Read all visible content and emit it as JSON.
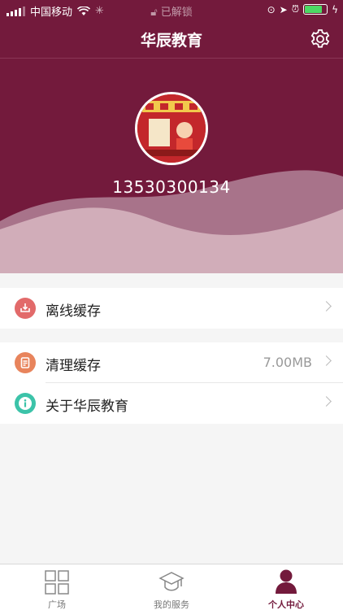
{
  "status_bar": {
    "carrier": "中国移动",
    "center": "已解锁"
  },
  "navbar": {
    "title": "华辰教育",
    "settings_icon": "gear-icon"
  },
  "profile": {
    "phone": "13530300134",
    "avatar_icon": "avatar"
  },
  "menu": {
    "offline_cache": {
      "label": "离线缓存",
      "icon": "download-icon",
      "color": "#e26a6a"
    },
    "clear_cache": {
      "label": "清理缓存",
      "value": "7.00MB",
      "icon": "document-icon",
      "color": "#e8845c"
    },
    "about": {
      "label": "关于华辰教育",
      "icon": "info-icon",
      "color": "#3cc3a9"
    }
  },
  "tabbar": {
    "tabs": [
      {
        "label": "广场",
        "icon": "grid-icon"
      },
      {
        "label": "我的服务",
        "icon": "graduation-cap-icon"
      },
      {
        "label": "个人中心",
        "icon": "person-icon",
        "active": true
      }
    ]
  },
  "colors": {
    "brand": "#731a3c",
    "background": "#f5f5f5"
  }
}
